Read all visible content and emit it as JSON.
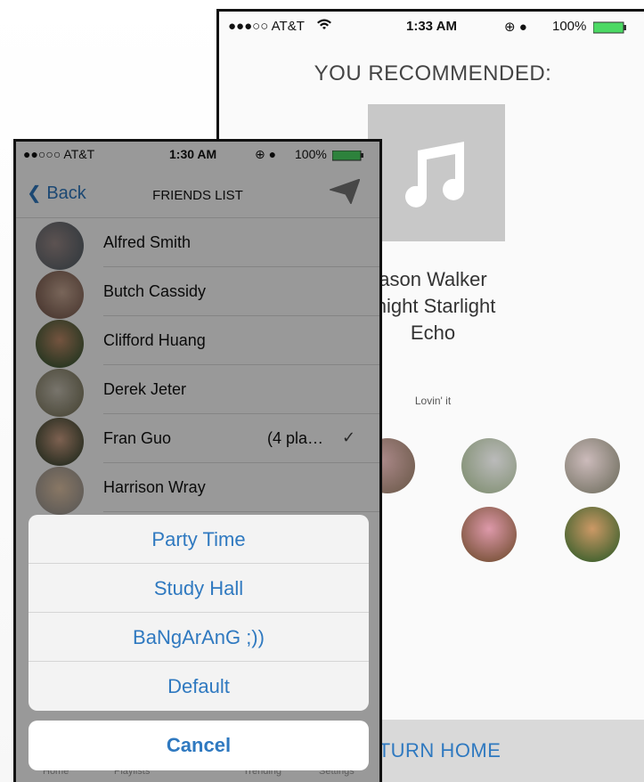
{
  "back_screen": {
    "status": {
      "carrier": "●●●○○ AT&T",
      "wifi": "wifi-icon",
      "time": "1:33 AM",
      "battery": "100%"
    },
    "title": "YOU RECOMMENDED:",
    "song": {
      "artist": "ason Walker",
      "title": "Inight Starlight",
      "album": "Echo"
    },
    "note": "Lovin' it",
    "return_button": "ETURN HOME",
    "colors": {
      "accent": "#2f79c0",
      "art_bg": "#c8c8c8"
    }
  },
  "front_screen": {
    "status": {
      "carrier": "●●○○○ AT&T",
      "time": "1:30 AM",
      "battery": "100%"
    },
    "nav": {
      "back_label": "Back",
      "title": "FRIENDS LIST"
    },
    "friends": [
      {
        "name": "Alfred Smith",
        "meta": ""
      },
      {
        "name": "Butch Cassidy",
        "meta": ""
      },
      {
        "name": "Clifford Huang",
        "meta": ""
      },
      {
        "name": "Derek Jeter",
        "meta": ""
      },
      {
        "name": "Fran Guo",
        "meta": "(4 pla…",
        "checked": true
      },
      {
        "name": "Harrison Wray",
        "meta": ""
      }
    ],
    "action_sheet": [
      "Party Time",
      "Study Hall",
      "BaNgArAnG ;))",
      "Default"
    ],
    "cancel_label": "Cancel",
    "tabbar": [
      "Home",
      "Playlists",
      "Trending",
      "Settings"
    ]
  }
}
